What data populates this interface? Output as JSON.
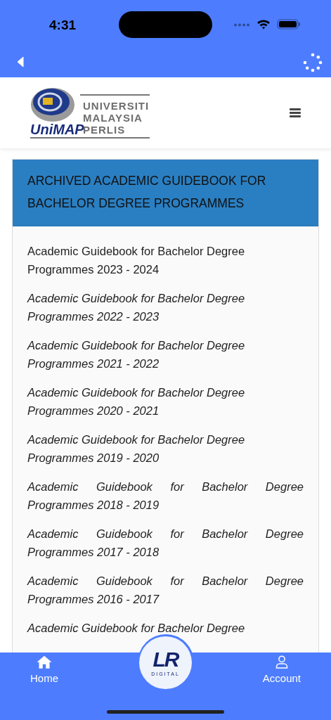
{
  "status_bar": {
    "time": "4:31"
  },
  "logo": {
    "lines": [
      "UNIVERSITI",
      "MALAYSIA",
      "PERLIS"
    ],
    "wordmark": "UniMAP"
  },
  "panel": {
    "title": "ARCHIVED ACADEMIC GUIDEBOOK FOR BACHELOR DEGREE PROGRAMMES",
    "items": [
      {
        "label": "Academic Guidebook for Bachelor Degree Programmes 2023 - 2024",
        "kind": "plain"
      },
      {
        "label": "Academic Guidebook for Bachelor Degree Programmes 2022 - 2023",
        "kind": "italic"
      },
      {
        "label": "Academic Guidebook for Bachelor Degree Programmes 2021 - 2022",
        "kind": "italic"
      },
      {
        "label": "Academic Guidebook for Bachelor Degree Programmes 2020 - 2021",
        "kind": "italic"
      },
      {
        "label": "Academic Guidebook for Bachelor Degree Programmes 2019 - 2020",
        "kind": "italic"
      },
      {
        "label": "Academic Guidebook for Bachelor Degree Programmes 2018 - 2019",
        "kind": "justified"
      },
      {
        "label": "Academic Guidebook for Bachelor Degree Programmes 2017 - 2018",
        "kind": "justified"
      },
      {
        "label": "Academic Guidebook for Bachelor Degree Programmes 2016 - 2017",
        "kind": "justified"
      },
      {
        "label": "Academic Guidebook for Bachelor Degree",
        "kind": "justified"
      }
    ]
  },
  "tab_bar": {
    "tabs": [
      {
        "label": "Home",
        "kind": "home"
      },
      {
        "label": "Account",
        "kind": "account"
      }
    ],
    "center": {
      "mark": "LR",
      "caption": "DIGITAL"
    }
  }
}
